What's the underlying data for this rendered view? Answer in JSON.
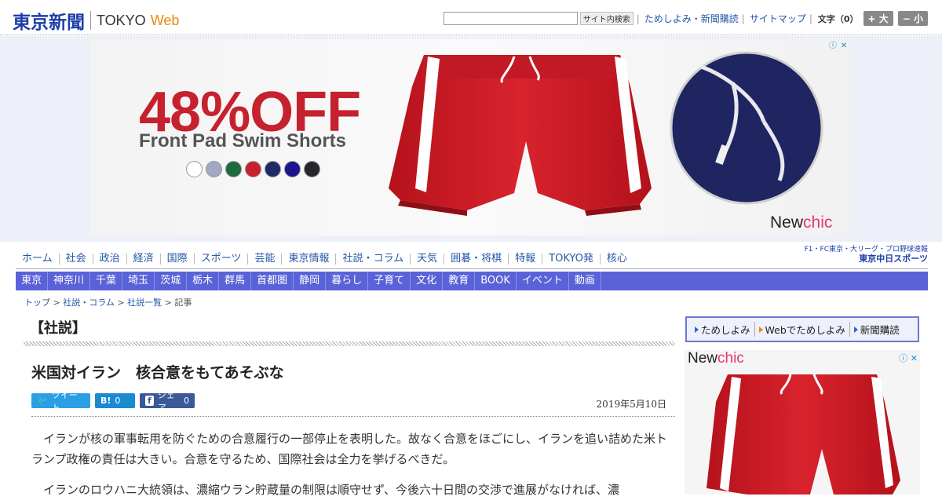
{
  "header": {
    "logo_jp": "東京新聞",
    "logo_tokyo": "TOKYO",
    "logo_web": "Web",
    "search_button": "サイト内検索",
    "links": [
      "ためしよみ・新聞購読",
      "サイトマップ"
    ],
    "text_size_label": "文字（0）",
    "size_up": "+ 大",
    "size_down": "− 小"
  },
  "ad_banner": {
    "headline": "48%OFF",
    "subline": "Front Pad Swim Shorts",
    "swatch_colors": [
      "#ffffff",
      "#a3a8c2",
      "#1e6b3d",
      "#c8202f",
      "#1f2a66",
      "#1b158f",
      "#26272b"
    ],
    "brand_new": "New",
    "brand_chic": "chic",
    "info_icon": "ⓘ",
    "close_icon": "✕"
  },
  "nav_primary": [
    "ホーム",
    "社会",
    "政治",
    "経済",
    "国際",
    "スポーツ",
    "芸能",
    "東京情報",
    "社説・コラム",
    "天気",
    "囲碁・将棋",
    "特報",
    "TOKYO発",
    "核心"
  ],
  "chunichi": {
    "line1": "F1・FC東京・大リーグ・プロ野球速報",
    "line2": "東京中日スポーツ"
  },
  "nav_regional": [
    "東京",
    "神奈川",
    "千葉",
    "埼玉",
    "茨城",
    "栃木",
    "群馬",
    "首都圏",
    "静岡",
    "暮らし",
    "子育て",
    "文化",
    "教育",
    "BOOK",
    "イベント",
    "動画"
  ],
  "breadcrumb": {
    "items": [
      "トップ",
      "社説・コラム",
      "社説一覧"
    ],
    "sep": ">",
    "current": "記事"
  },
  "article": {
    "section": "【社説】",
    "headline": "米国対イラン　核合意をもてあそぶな",
    "share": {
      "tweet": "ツイート",
      "hatena_icon": "B!",
      "hatena_count": "0",
      "fb_icon": "f",
      "fb_label": "シェア",
      "fb_count": "0"
    },
    "date": "2019年5月10日",
    "paragraphs": [
      "イランが核の軍事転用を防ぐための合意履行の一部停止を表明した。故なく合意をほごにし、イランを追い詰めた米トランプ政権の責任は大きい。合意を守るため、国際社会は全力を挙げるべきだ。",
      "イランのロウハニ大統領は、濃縮ウラン貯蔵量の制限は順守せず、今後六十日間の交渉で進展がなければ、濃"
    ]
  },
  "sidebar": {
    "links": [
      "ためしよみ",
      "Webでためしよみ",
      "新聞購読"
    ],
    "ad_brand_new": "New",
    "ad_brand_chic": "chic",
    "ad_info_icon": "ⓘ",
    "ad_close_icon": "✕"
  }
}
